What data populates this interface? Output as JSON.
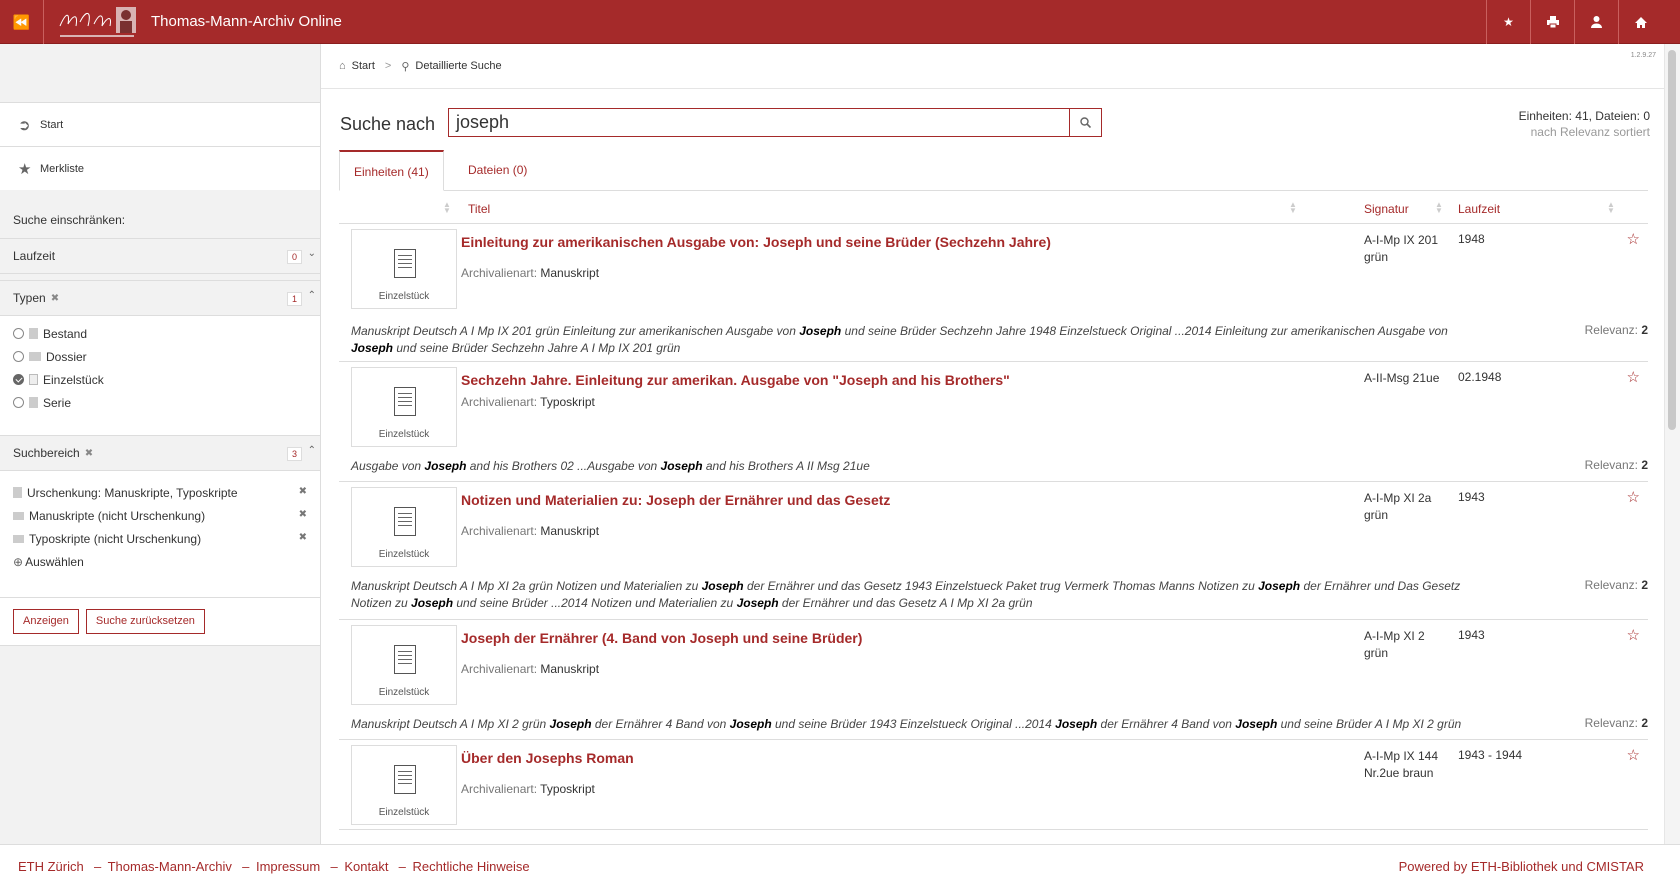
{
  "app": {
    "title": "Thomas-Mann-Archiv Online",
    "version": "1.2.9.27"
  },
  "breadcrumb": {
    "home": "Start",
    "current": "Detaillierte Suche"
  },
  "sidebar": {
    "start_label": "Start",
    "merkliste_label": "Merkliste",
    "filter_title": "Suche einschränken:",
    "laufzeit": {
      "label": "Laufzeit",
      "count": "0"
    },
    "typen": {
      "label": "Typen",
      "count": "1",
      "options": [
        "Bestand",
        "Dossier",
        "Einzelstück",
        "Serie"
      ],
      "selected": "Einzelstück"
    },
    "suchbereich": {
      "label": "Suchbereich",
      "count": "3",
      "items": [
        "Urschenkung: Manuskripte, Typoskripte",
        "Manuskripte (nicht Urschenkung)",
        "Typoskripte (nicht Urschenkung)"
      ],
      "add_label": "Auswählen"
    },
    "show_button": "Anzeigen",
    "reset_button": "Suche zurücksetzen"
  },
  "search": {
    "label": "Suche nach",
    "value": "joseph",
    "counts": "Einheiten: 41, Dateien: 0",
    "sort": "nach Relevanz sortiert"
  },
  "tabs": [
    {
      "label": "Einheiten (41)",
      "active": true
    },
    {
      "label": "Dateien (0)",
      "active": false
    }
  ],
  "columns": {
    "title": "Titel",
    "signature": "Signatur",
    "date": "Laufzeit"
  },
  "results": [
    {
      "title": "Einleitung zur amerikanischen Ausgabe von: Joseph und seine Brüder (Sechzehn Jahre)",
      "type_label": "Archivalienart:",
      "type": "Manuskript",
      "thumb_label": "Einzelstück",
      "signature": "A-I-Mp IX 201 grün",
      "date": "1948",
      "relevance_label": "Relevanz:",
      "relevance": "2",
      "snippet": [
        "Manuskript Deutsch A I Mp IX 201 grün Einleitung zur amerikanischen Ausgabe von ",
        "Joseph",
        " und seine Brüder Sechzehn Jahre 1948 Einzelstueck Original ...2014 Einleitung zur amerikanischen Ausgabe von ",
        "Joseph",
        " und seine Brüder Sechzehn Jahre A I Mp IX 201 grün"
      ]
    },
    {
      "title": "Sechzehn Jahre. Einleitung zur amerikan. Ausgabe von \"Joseph and his Brothers\"",
      "type_label": "Archivalienart:",
      "type": "Typoskript",
      "thumb_label": "Einzelstück",
      "signature": "A-II-Msg 21ue",
      "date": "02.1948",
      "relevance_label": "Relevanz:",
      "relevance": "2",
      "snippet": [
        "Ausgabe von ",
        "Joseph",
        " and his Brothers 02 ...Ausgabe von ",
        "Joseph",
        " and his Brothers A II Msg 21ue"
      ]
    },
    {
      "title": "Notizen und Materialien zu: Joseph der Ernährer und das Gesetz",
      "type_label": "Archivalienart:",
      "type": "Manuskript",
      "thumb_label": "Einzelstück",
      "signature": "A-I-Mp XI 2a grün",
      "date": "1943",
      "relevance_label": "Relevanz:",
      "relevance": "2",
      "snippet": [
        "Manuskript Deutsch A I Mp XI 2a grün Notizen und Materialien zu ",
        "Joseph",
        " der Ernährer und das Gesetz 1943 Einzelstueck Paket trug Vermerk Thomas Manns Notizen zu ",
        "Joseph",
        " der Ernährer und Das Gesetz Notizen zu ",
        "Joseph",
        " und seine Brüder ...2014 Notizen und Materialien zu ",
        "Joseph",
        " der Ernährer und das Gesetz A I Mp XI 2a grün"
      ]
    },
    {
      "title": "Joseph der Ernährer (4. Band von Joseph und seine Brüder)",
      "type_label": "Archivalienart:",
      "type": "Manuskript",
      "thumb_label": "Einzelstück",
      "signature": "A-I-Mp XI 2 grün",
      "date": "1943",
      "relevance_label": "Relevanz:",
      "relevance": "2",
      "snippet": [
        "Manuskript Deutsch A I Mp XI 2 grün ",
        "Joseph",
        " der Ernährer 4 Band von ",
        "Joseph",
        " und seine Brüder 1943 Einzelstueck Original ...2014 ",
        "Joseph",
        " der Ernährer 4 Band von ",
        "Joseph",
        " und seine Brüder A I Mp XI 2 grün"
      ]
    },
    {
      "title": "Über den Josephs Roman",
      "type_label": "Archivalienart:",
      "type": "Typoskript",
      "thumb_label": "Einzelstück",
      "signature": "A-I-Mp IX 144 Nr.2ue braun",
      "date": "1943 - 1944",
      "relevance_label": "Relevanz:",
      "relevance": "2",
      "snippet": []
    }
  ],
  "footer": {
    "links": [
      "ETH Zürich",
      "Thomas-Mann-Archiv",
      "Impressum",
      "Kontakt",
      "Rechtliche Hinweise"
    ],
    "powered": "Powered by ETH-Bibliothek und CMISTAR"
  }
}
